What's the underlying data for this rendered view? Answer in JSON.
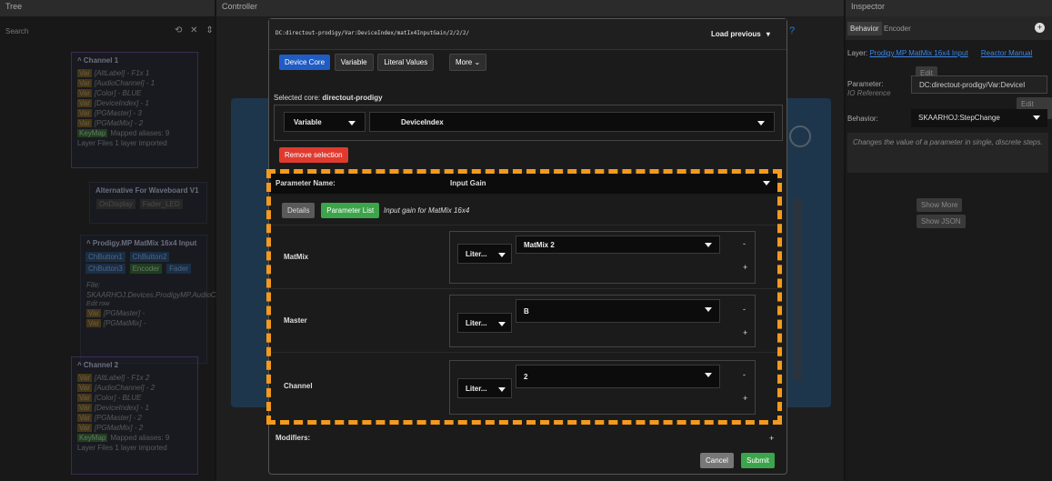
{
  "panels": {
    "tree": "Tree",
    "controller": "Controller",
    "inspector": "Inspector"
  },
  "search": {
    "placeholder": "Search"
  },
  "tree": {
    "channel1": {
      "title": "Channel 1",
      "rows": [
        [
          "Var",
          "[AltLabel]",
          "F1x 1"
        ],
        [
          "Var",
          "[AudioChannel]",
          "1"
        ],
        [
          "Var",
          "[Color]",
          "BLUE"
        ],
        [
          "Var",
          "[DeviceIndex]",
          "1"
        ],
        [
          "Var",
          "[PGMaster]",
          "3"
        ],
        [
          "Var",
          "[PGMatMix]",
          "2"
        ]
      ],
      "keymap": "KeyMap",
      "mapped": "Mapped aliases: 9",
      "layer_files": "Layer Files 1 layer imported"
    },
    "alt": {
      "title": "Alternative For Waveboard V1",
      "chips": [
        "OnDisplay",
        "Fader_LED"
      ]
    },
    "prodigy": {
      "title": "Prodigy.MP MatMix 16x4 Input",
      "chips": [
        "ChButton1",
        "ChButton2",
        "ChButton3",
        "Encoder",
        "Fader"
      ],
      "file_label": "File:",
      "file_path": "SKAARHOJ.Devices.ProdigyMP.AudioClass.M",
      "edit": "Edit row",
      "rows": [
        [
          "Var",
          "[PGMaster]"
        ],
        [
          "Var",
          "[PGMatMix]"
        ]
      ]
    },
    "channel2": {
      "title": "Channel 2",
      "rows": [
        [
          "Var",
          "[AltLabel]",
          "F1x 2"
        ],
        [
          "Var",
          "[AudioChannel]",
          "2"
        ],
        [
          "Var",
          "[Color]",
          "BLUE"
        ],
        [
          "Var",
          "[DeviceIndex]",
          "1"
        ],
        [
          "Var",
          "[PGMaster]",
          "2"
        ],
        [
          "Var",
          "[PGMatMix]",
          "2"
        ]
      ],
      "keymap": "KeyMap",
      "mapped": "Mapped aliases: 9",
      "layer_files": "Layer Files 1 layer imported"
    }
  },
  "modal": {
    "path": "DC:directout-prodigy/Var:DeviceIndex/matIx4InputGain/2/2/2/",
    "load_previous": "Load previous",
    "tabs": [
      "Device Core",
      "Variable",
      "Literal Values",
      "More"
    ],
    "selected_core_label": "Selected core:",
    "selected_core_value": "directout-prodigy",
    "type_select": "Variable",
    "core_select": "DeviceIndex",
    "remove": "Remove selection",
    "parameter_name_label": "Parameter Name:",
    "parameter_name_value": "Input Gain",
    "details": "Details",
    "parameter_list": "Parameter List",
    "description": "Input gain for MatMix 16x4",
    "params": [
      {
        "label": "MatMix",
        "type": "Liter...",
        "value": "MatMix 2"
      },
      {
        "label": "Master",
        "type": "Liter...",
        "value": "B"
      },
      {
        "label": "Channel",
        "type": "Liter...",
        "value": "2"
      }
    ],
    "minus": "-",
    "plus": "+",
    "modifiers": "Modifiers:",
    "cancel": "Cancel",
    "submit": "Submit"
  },
  "inspector": {
    "tabs": [
      "Behavior",
      "Encoder"
    ],
    "layer_label": "Layer:",
    "layer_link": "Prodigy.MP MatMix 16x4 Input",
    "reactor_manual": "Reactor Manual",
    "edit": "Edit",
    "parameter_label": "Parameter:",
    "io_reference": "IO Reference",
    "parameter_value": "DC:directout-prodigy/Var:DeviceI",
    "edit_raw": "Edit Raw",
    "behavior_label": "Behavior:",
    "behavior_value": "SKAARHOJ:StepChange",
    "description": "Changes the value of a parameter in single, discrete steps.",
    "show_more": "Show More",
    "show_json": "Show JSON"
  }
}
